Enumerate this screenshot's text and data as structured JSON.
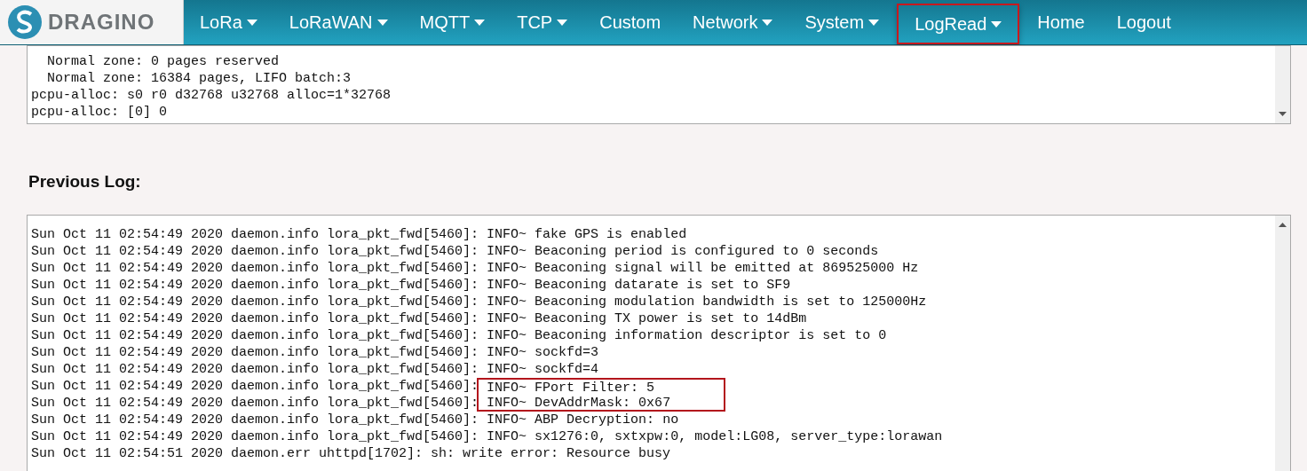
{
  "brand": {
    "name": "DRAGINO"
  },
  "nav": [
    {
      "label": "LoRa",
      "has_menu": true,
      "selected": false
    },
    {
      "label": "LoRaWAN",
      "has_menu": true,
      "selected": false
    },
    {
      "label": "MQTT",
      "has_menu": true,
      "selected": false
    },
    {
      "label": "TCP",
      "has_menu": true,
      "selected": false
    },
    {
      "label": "Custom",
      "has_menu": false,
      "selected": false
    },
    {
      "label": "Network",
      "has_menu": true,
      "selected": false
    },
    {
      "label": "System",
      "has_menu": true,
      "selected": false
    },
    {
      "label": "LogRead",
      "has_menu": true,
      "selected": true
    },
    {
      "label": "Home",
      "has_menu": false,
      "selected": false
    },
    {
      "label": "Logout",
      "has_menu": false,
      "selected": false
    }
  ],
  "system_log": {
    "lines": [
      "  Normal zone: 0 pages reserved",
      "  Normal zone: 16384 pages, LIFO batch:3",
      "pcpu-alloc: s0 r0 d32768 u32768 alloc=1*32768",
      "pcpu-alloc: [0] 0"
    ]
  },
  "previous_log": {
    "title": "Previous Log:",
    "lines": [
      {
        "source": "Sun Oct 11 02:54:49 2020 daemon.info lora_pkt_fwd[5460]:",
        "message": "INFO~ fake GPS is enabled",
        "highlighted": false
      },
      {
        "source": "Sun Oct 11 02:54:49 2020 daemon.info lora_pkt_fwd[5460]:",
        "message": "INFO~ Beaconing period is configured to 0 seconds",
        "highlighted": false
      },
      {
        "source": "Sun Oct 11 02:54:49 2020 daemon.info lora_pkt_fwd[5460]:",
        "message": "INFO~ Beaconing signal will be emitted at 869525000 Hz",
        "highlighted": false
      },
      {
        "source": "Sun Oct 11 02:54:49 2020 daemon.info lora_pkt_fwd[5460]:",
        "message": "INFO~ Beaconing datarate is set to SF9",
        "highlighted": false
      },
      {
        "source": "Sun Oct 11 02:54:49 2020 daemon.info lora_pkt_fwd[5460]:",
        "message": "INFO~ Beaconing modulation bandwidth is set to 125000Hz",
        "highlighted": false
      },
      {
        "source": "Sun Oct 11 02:54:49 2020 daemon.info lora_pkt_fwd[5460]:",
        "message": "INFO~ Beaconing TX power is set to 14dBm",
        "highlighted": false
      },
      {
        "source": "Sun Oct 11 02:54:49 2020 daemon.info lora_pkt_fwd[5460]:",
        "message": "INFO~ Beaconing information descriptor is set to 0",
        "highlighted": false
      },
      {
        "source": "Sun Oct 11 02:54:49 2020 daemon.info lora_pkt_fwd[5460]:",
        "message": "INFO~ sockfd=3",
        "highlighted": false
      },
      {
        "source": "Sun Oct 11 02:54:49 2020 daemon.info lora_pkt_fwd[5460]:",
        "message": "INFO~ sockfd=4",
        "highlighted": false
      },
      {
        "source": "Sun Oct 11 02:54:49 2020 daemon.info lora_pkt_fwd[5460]:",
        "message": "INFO~ FPort Filter: 5",
        "highlighted": true
      },
      {
        "source": "Sun Oct 11 02:54:49 2020 daemon.info lora_pkt_fwd[5460]:",
        "message": "INFO~ DevAddrMask: 0x67",
        "highlighted": true
      },
      {
        "source": "Sun Oct 11 02:54:49 2020 daemon.info lora_pkt_fwd[5460]:",
        "message": "INFO~ ABP Decryption: no",
        "highlighted": false
      },
      {
        "source": "Sun Oct 11 02:54:49 2020 daemon.info lora_pkt_fwd[5460]:",
        "message": "INFO~ sx1276:0, sxtxpw:0, model:LG08, server_type:lorawan",
        "highlighted": false
      },
      {
        "source": "Sun Oct 11 02:54:51 2020 daemon.err uhttpd[1702]:",
        "message": "sh: write error: Resource busy",
        "highlighted": false
      }
    ]
  }
}
